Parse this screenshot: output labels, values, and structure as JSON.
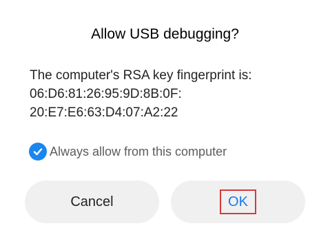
{
  "dialog": {
    "title": "Allow USB debugging?",
    "message_lines": [
      "The computer's RSA key fingerprint is:",
      "06:D6:81:26:95:9D:8B:0F:",
      "20:E7:E6:63:D4:07:A2:22"
    ],
    "checkbox": {
      "label": "Always allow from this computer",
      "checked": true,
      "icon": "checkmark-icon"
    },
    "buttons": {
      "cancel": "Cancel",
      "ok": "OK"
    }
  },
  "colors": {
    "accent": "#1a86f0",
    "ok_text": "#1a7ae8",
    "highlight_border": "#d63a3a",
    "button_bg": "#f0f0f0"
  }
}
